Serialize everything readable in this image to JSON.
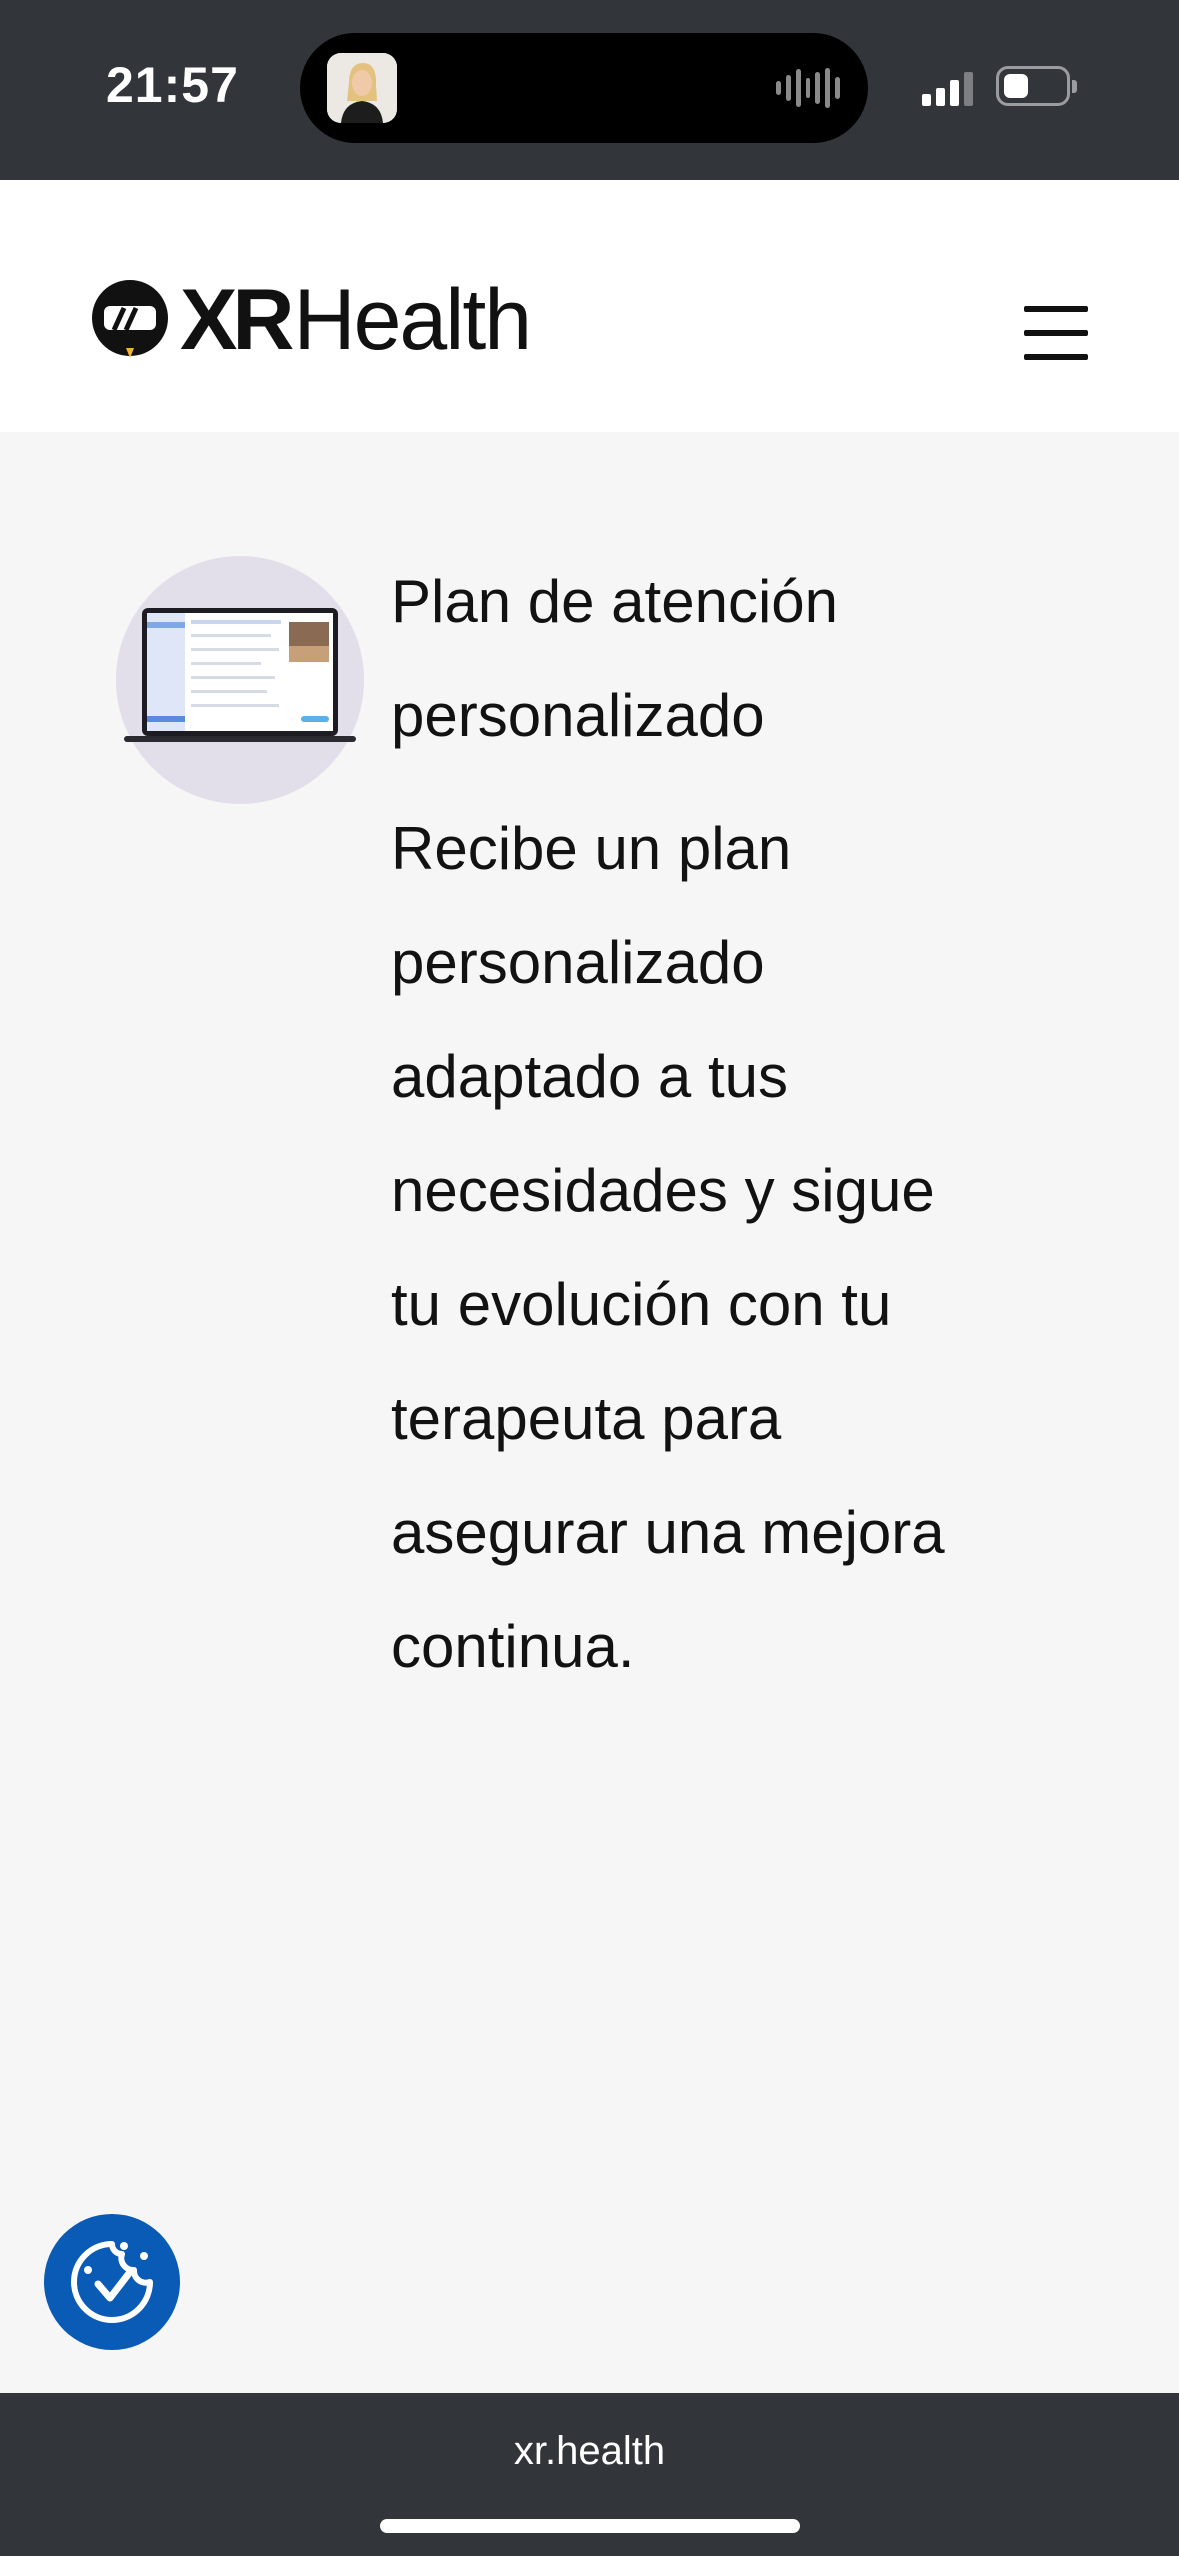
{
  "status_bar": {
    "time": "21:57"
  },
  "header": {
    "logo_bold": "XR",
    "logo_light": "Health"
  },
  "feature": {
    "title": "Plan de atención personalizado",
    "description": "Recibe un plan personalizado adaptado a tus necesidades y sigue tu evolución con tu terapeuta para asegurar una mejora continua."
  },
  "browser": {
    "url": "xr.health"
  },
  "colors": {
    "status_bar_bg": "#323539",
    "page_bg": "#f6f6f6",
    "cookie_button": "#0a5bb5",
    "illustration_circle": "#e2dfea"
  }
}
